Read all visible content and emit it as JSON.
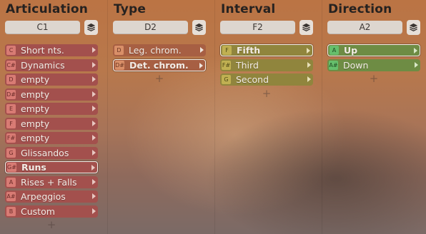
{
  "columns": [
    {
      "title": "Articulation",
      "key": "C1",
      "theme": "red",
      "selected_index": 8,
      "items": [
        {
          "note": "C",
          "label": "Short nts."
        },
        {
          "note": "C#",
          "label": "Dynamics"
        },
        {
          "note": "D",
          "label": "empty"
        },
        {
          "note": "D#",
          "label": "empty"
        },
        {
          "note": "E",
          "label": "empty"
        },
        {
          "note": "F",
          "label": "empty"
        },
        {
          "note": "F#",
          "label": "empty"
        },
        {
          "note": "G",
          "label": "Glissandos"
        },
        {
          "note": "G#",
          "label": "Runs"
        },
        {
          "note": "A",
          "label": "Rises + Falls"
        },
        {
          "note": "A#",
          "label": "Arpeggios"
        },
        {
          "note": "B",
          "label": "Custom"
        }
      ]
    },
    {
      "title": "Type",
      "key": "D2",
      "theme": "orange",
      "selected_index": 1,
      "items": [
        {
          "note": "D",
          "label": "Leg. chrom."
        },
        {
          "note": "D#",
          "label": "Det. chrom."
        }
      ]
    },
    {
      "title": "Interval",
      "key": "F2",
      "theme": "olive",
      "selected_index": 0,
      "items": [
        {
          "note": "F",
          "label": "Fifth"
        },
        {
          "note": "F#",
          "label": "Third"
        },
        {
          "note": "G",
          "label": "Second"
        }
      ]
    },
    {
      "title": "Direction",
      "key": "A2",
      "theme": "green",
      "selected_index": 0,
      "items": [
        {
          "note": "A",
          "label": "Up"
        },
        {
          "note": "A#",
          "label": "Down"
        }
      ]
    }
  ],
  "add_label": "+",
  "icons": {
    "layers": "layers-icon",
    "chevron": "chevron-right-icon",
    "add": "plus-icon"
  }
}
